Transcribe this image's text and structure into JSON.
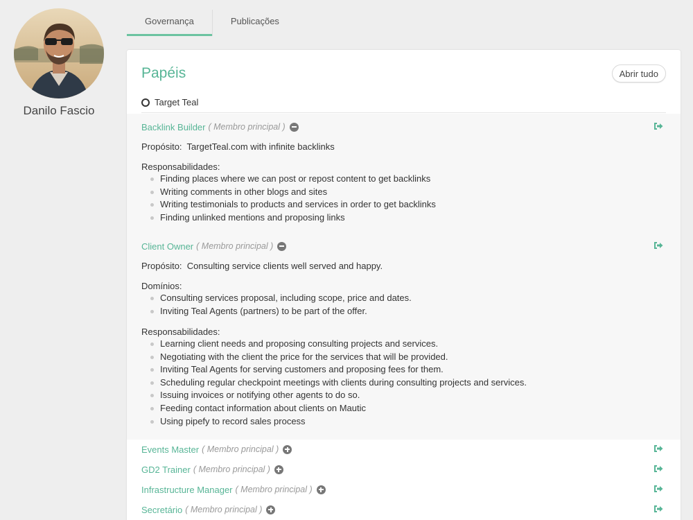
{
  "profile": {
    "name": "Danilo Fascio"
  },
  "tabs": [
    {
      "label": "Governança",
      "active": true
    },
    {
      "label": "Publicações",
      "active": false
    }
  ],
  "roles_panel": {
    "title": "Papéis",
    "open_all_label": "Abrir tudo",
    "circle_name": "Target Teal"
  },
  "labels": {
    "purpose": "Propósito:",
    "domains": "Domínios:",
    "accountabilities": "Responsabilidades:"
  },
  "roles": [
    {
      "name": "Backlink Builder",
      "membership": "( Membro principal )",
      "expanded": true,
      "purpose": "TargetTeal.com with infinite backlinks",
      "accountabilities": [
        "Finding places where we can post or repost content to get backlinks",
        "Writing comments in other blogs and sites",
        "Writing testimonials to products and services in order to get backlinks",
        "Finding unlinked mentions and proposing links"
      ]
    },
    {
      "name": "Client Owner",
      "membership": "( Membro principal )",
      "expanded": true,
      "purpose": "Consulting service clients well served and happy.",
      "domains": [
        "Consulting services proposal, including scope, price and dates.",
        "Inviting Teal Agents (partners) to be part of the offer."
      ],
      "accountabilities": [
        "Learning client needs and proposing consulting projects and services.",
        "Negotiating with the client the price for the services that will be provided.",
        "Inviting Teal Agents for serving customers and proposing fees for them.",
        "Scheduling regular checkpoint meetings with clients during consulting projects and services.",
        "Issuing invoices or notifying other agents to do so.",
        "Feeding contact information about clients on Mautic",
        "Using pipefy to record sales process"
      ]
    },
    {
      "name": "Events Master",
      "membership": "( Membro principal )",
      "expanded": false
    },
    {
      "name": "GD2 Trainer",
      "membership": "( Membro principal )",
      "expanded": false
    },
    {
      "name": "Infrastructure Manager",
      "membership": "( Membro principal )",
      "expanded": false
    },
    {
      "name": "Secretário",
      "membership": "( Membro principal )",
      "expanded": false
    }
  ],
  "colors": {
    "accent": "#57b596",
    "tab_underline": "#6cc3a0",
    "icon_gray": "#777777",
    "background": "#eeeeee"
  },
  "icons": {
    "collapse": "minus-circle-icon",
    "expand": "plus-circle-icon",
    "exit": "sign-out-icon",
    "circle": "circle-outline-icon"
  }
}
